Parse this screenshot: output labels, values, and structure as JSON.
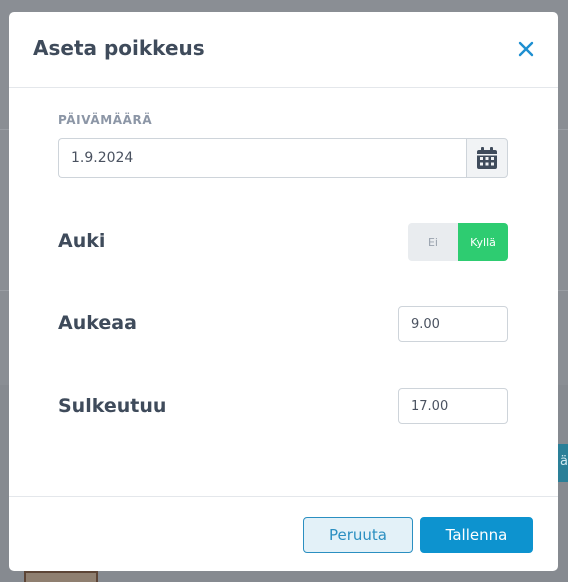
{
  "modal": {
    "title": "Aseta poikkeus",
    "close_icon": "close-icon"
  },
  "date": {
    "label": "PÄIVÄMÄÄRÄ",
    "value": "1.9.2024",
    "calendar_icon": "calendar-icon"
  },
  "open": {
    "label": "Auki",
    "options": [
      "Ei",
      "Kyllä"
    ],
    "selected": "Kyllä",
    "active_color": "#2ecc71"
  },
  "opens": {
    "label": "Aukeaa",
    "value": "9.00"
  },
  "closes": {
    "label": "Sulkeutuu",
    "value": "17.00"
  },
  "footer": {
    "cancel_label": "Peruuta",
    "save_label": "Tallenna"
  },
  "colors": {
    "accent": "#0d93cf",
    "title": "#3f4b5b"
  }
}
